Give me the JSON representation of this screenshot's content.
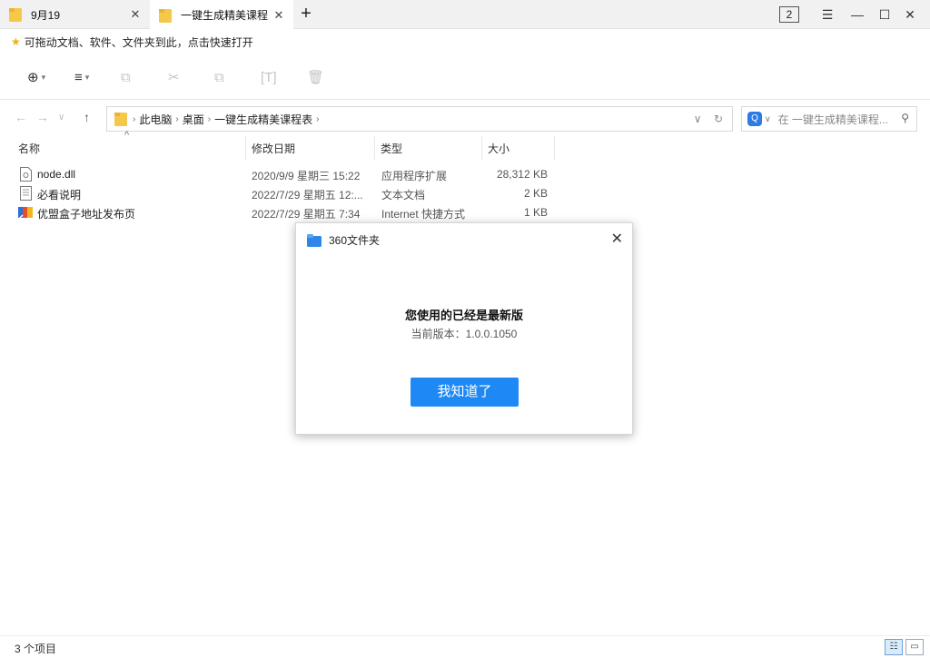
{
  "tabs": [
    {
      "label": "9月19",
      "active": false
    },
    {
      "label": "一键生成精美课程",
      "active": true
    }
  ],
  "window": {
    "count": "2"
  },
  "favorites": {
    "hint": "可拖动文档、软件、文件夹到此，点击快速打开"
  },
  "breadcrumb": [
    "此电脑",
    "桌面",
    "一键生成精美课程表"
  ],
  "search": {
    "placeholder": "在 一键生成精美课程..."
  },
  "columns": {
    "name": "名称",
    "date": "修改日期",
    "type": "类型",
    "size": "大小"
  },
  "files": [
    {
      "name": "node.dll",
      "date": "2020/9/9 星期三 15:22",
      "type": "应用程序扩展",
      "size": "28,312 KB",
      "icon": "dll-file-icon"
    },
    {
      "name": "必看说明",
      "date": "2022/7/29 星期五 12:...",
      "type": "文本文档",
      "size": "2 KB",
      "icon": "text-file-icon"
    },
    {
      "name": "优盟盒子地址发布页",
      "date": "2022/7/29 星期五 7:34",
      "type": "Internet 快捷方式",
      "size": "1 KB",
      "icon": "internet-shortcut-icon"
    }
  ],
  "dialog": {
    "title": "360文件夹",
    "message": "您使用的已经是最新版",
    "version": "当前版本：1.0.0.1050",
    "ok_label": "我知道了"
  },
  "status": {
    "item_count": "3 个项目"
  },
  "colors": {
    "accent": "#1e88f5",
    "folder": "#f5c84a",
    "star": "#f0b400"
  }
}
